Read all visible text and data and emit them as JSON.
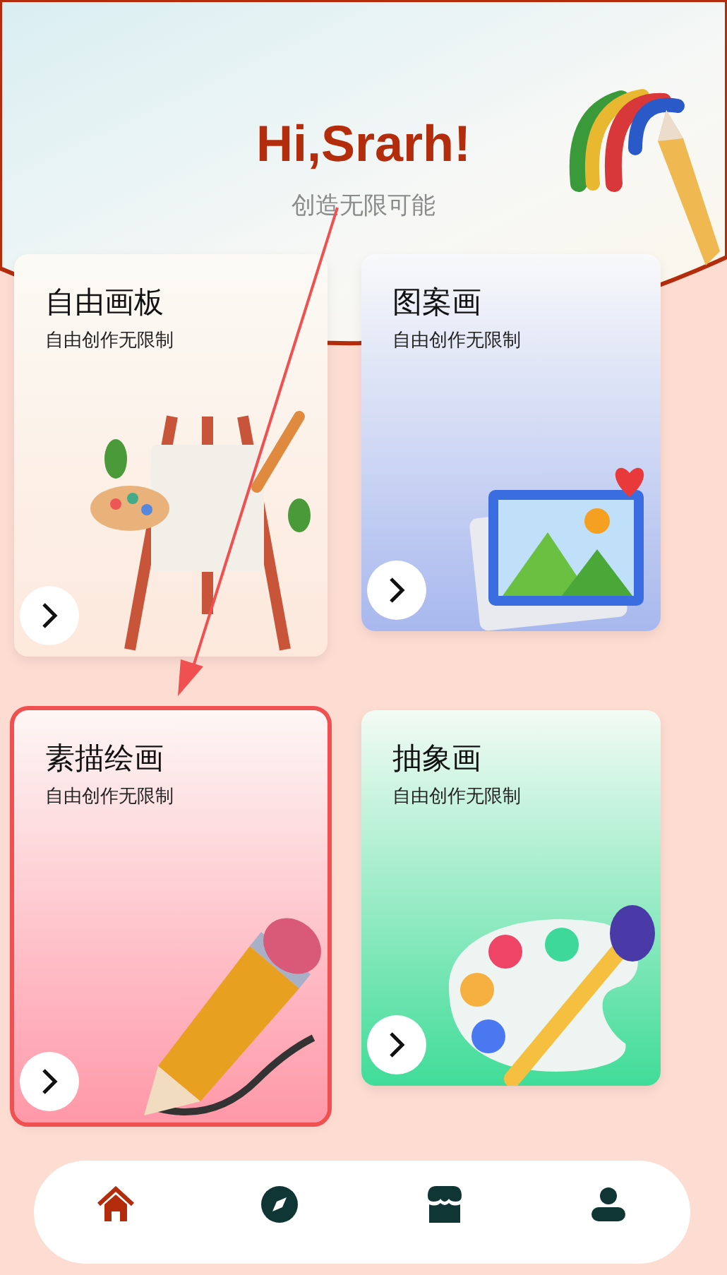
{
  "header": {
    "greeting": "Hi,Srarh!",
    "subtitle": "创造无限可能"
  },
  "cards": [
    {
      "kind": "easel",
      "title": "自由画板",
      "subtitle": "自由创作无限制",
      "highlighted": false
    },
    {
      "kind": "picture",
      "title": "图案画",
      "subtitle": "自由创作无限制",
      "highlighted": false
    },
    {
      "kind": "pencil",
      "title": "素描绘画",
      "subtitle": "自由创作无限制",
      "highlighted": true
    },
    {
      "kind": "palette",
      "title": "抽象画",
      "subtitle": "自由创作无限制",
      "highlighted": false
    }
  ],
  "nav": [
    {
      "kind": "home",
      "selected": true
    },
    {
      "kind": "compass",
      "selected": false
    },
    {
      "kind": "store",
      "selected": false
    },
    {
      "kind": "user",
      "selected": false
    }
  ]
}
